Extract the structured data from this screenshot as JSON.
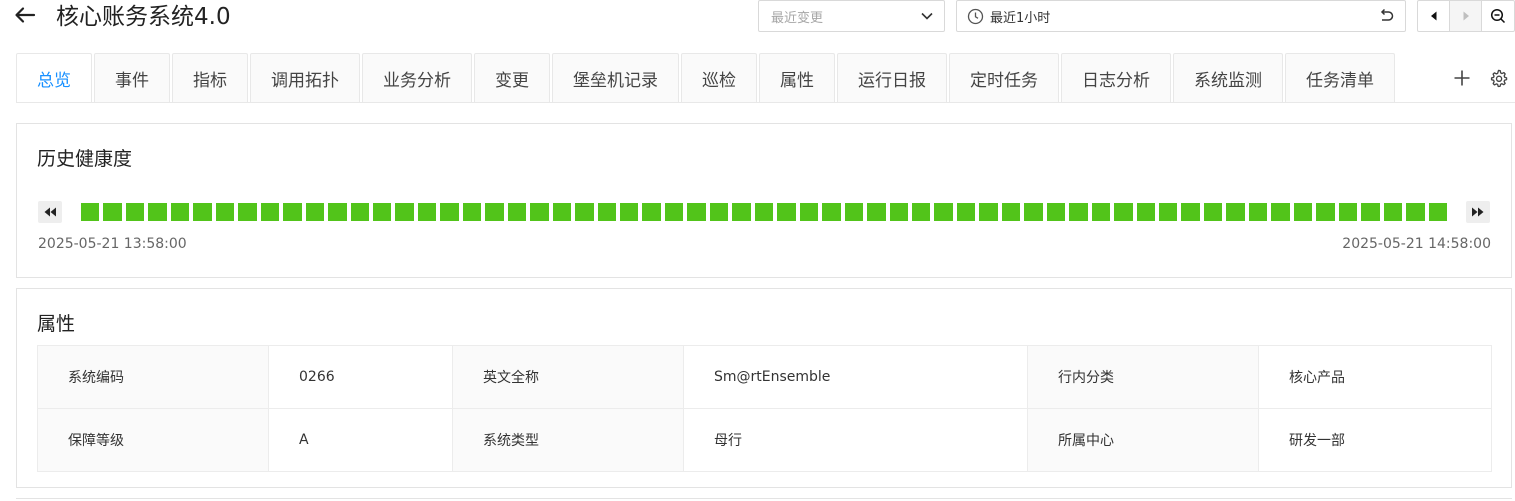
{
  "header": {
    "title": "核心账务系统4.0",
    "change_select_placeholder": "最近变更",
    "time_range": "最近1小时"
  },
  "tabs": [
    {
      "label": "总览",
      "active": true
    },
    {
      "label": "事件",
      "active": false
    },
    {
      "label": "指标",
      "active": false
    },
    {
      "label": "调用拓扑",
      "active": false
    },
    {
      "label": "业务分析",
      "active": false
    },
    {
      "label": "变更",
      "active": false
    },
    {
      "label": "堡垒机记录",
      "active": false
    },
    {
      "label": "巡检",
      "active": false
    },
    {
      "label": "属性",
      "active": false
    },
    {
      "label": "运行日报",
      "active": false
    },
    {
      "label": "定时任务",
      "active": false
    },
    {
      "label": "日志分析",
      "active": false
    },
    {
      "label": "系统监测",
      "active": false
    },
    {
      "label": "任务清单",
      "active": false
    }
  ],
  "health": {
    "title": "历史健康度",
    "start_time": "2025-05-21 13:58:00",
    "end_time": "2025-05-21 14:58:00",
    "segment_count": 61,
    "status_color": "#52c41a"
  },
  "attributes": {
    "title": "属性",
    "rows": [
      [
        {
          "key": "系统编码",
          "value": "0266"
        },
        {
          "key": "英文全称",
          "value": "Sm@rtEnsemble"
        },
        {
          "key": "行内分类",
          "value": "核心产品"
        }
      ],
      [
        {
          "key": "保障等级",
          "value": "A"
        },
        {
          "key": "系统类型",
          "value": "母行"
        },
        {
          "key": "所属中心",
          "value": "研发一部"
        }
      ]
    ]
  },
  "colors": {
    "accent": "#1890ff",
    "healthy": "#52c41a"
  }
}
